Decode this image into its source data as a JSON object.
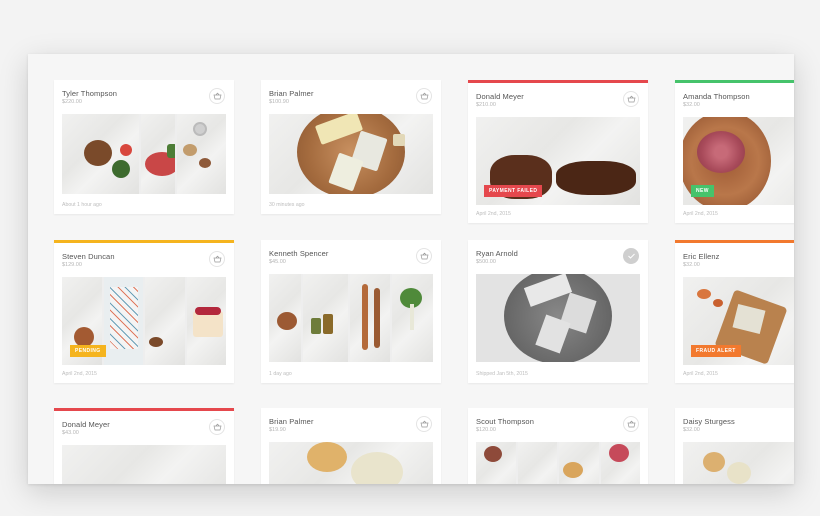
{
  "cards": [
    {
      "name": "Tyler Thompson",
      "price": "$220.00",
      "footer": "About 1 hour ago",
      "badge": ""
    },
    {
      "name": "Brian Palmer",
      "price": "$100.90",
      "footer": "30 minutes ago",
      "badge": ""
    },
    {
      "name": "Donald Meyer",
      "price": "$210.00",
      "footer": "April 2nd, 2015",
      "badge": "PAYMENT FAILED"
    },
    {
      "name": "Amanda Thompson",
      "price": "$32.00",
      "footer": "April 2nd, 2015",
      "badge": "NEW"
    },
    {
      "name": "Steven Duncan",
      "price": "$129.00",
      "footer": "April 2nd, 2015",
      "badge": "PENDING"
    },
    {
      "name": "Kenneth Spencer",
      "price": "$45.00",
      "footer": "1 day ago",
      "badge": ""
    },
    {
      "name": "Ryan Arnold",
      "price": "$500.00",
      "footer": "Shipped Jan 5th, 2015",
      "badge": ""
    },
    {
      "name": "Eric Ellenz",
      "price": "$32.00",
      "footer": "April 2nd, 2015",
      "badge": "FRAUD ALERT"
    },
    {
      "name": "Donald Meyer",
      "price": "$43.00",
      "footer": "",
      "badge": ""
    },
    {
      "name": "Brian Palmer",
      "price": "$19.90",
      "footer": "",
      "badge": ""
    },
    {
      "name": "Scout Thompson",
      "price": "$120.00",
      "footer": "",
      "badge": ""
    },
    {
      "name": "Daisy Sturgess",
      "price": "$32.00",
      "footer": "",
      "badge": ""
    }
  ],
  "icons": {
    "basket": "basket-icon",
    "check": "checkmark-icon"
  },
  "colors": {
    "red": "#e5484d",
    "green": "#46c36b",
    "yellow": "#f5b41e",
    "orange": "#f2792e"
  }
}
